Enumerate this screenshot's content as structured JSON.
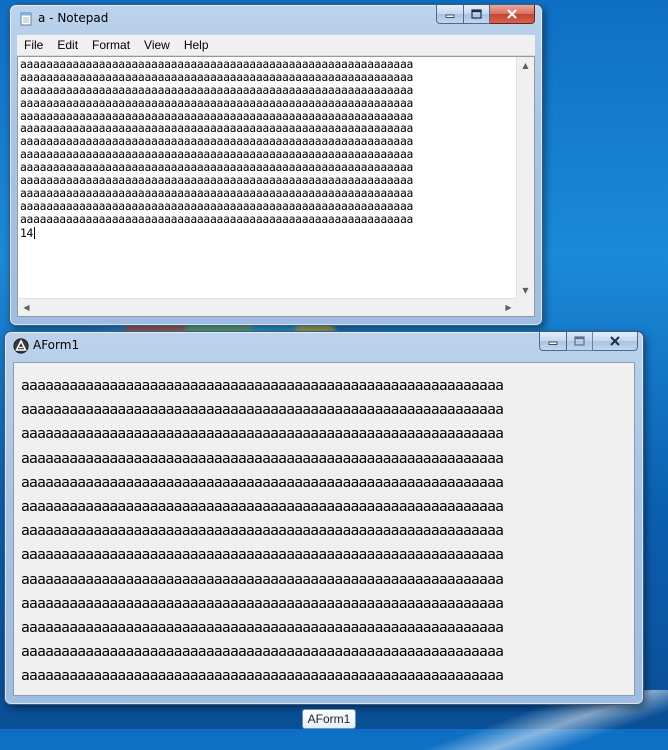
{
  "notepad": {
    "title": "a - Notepad",
    "menu": [
      "File",
      "Edit",
      "Format",
      "View",
      "Help"
    ],
    "lines": [
      "aaaaaaaaaaaaaaaaaaaaaaaaaaaaaaaaaaaaaaaaaaaaaaaaaaaaaaaaaaaa",
      "aaaaaaaaaaaaaaaaaaaaaaaaaaaaaaaaaaaaaaaaaaaaaaaaaaaaaaaaaaaa",
      "aaaaaaaaaaaaaaaaaaaaaaaaaaaaaaaaaaaaaaaaaaaaaaaaaaaaaaaaaaaa",
      "aaaaaaaaaaaaaaaaaaaaaaaaaaaaaaaaaaaaaaaaaaaaaaaaaaaaaaaaaaaa",
      "aaaaaaaaaaaaaaaaaaaaaaaaaaaaaaaaaaaaaaaaaaaaaaaaaaaaaaaaaaaa",
      "aaaaaaaaaaaaaaaaaaaaaaaaaaaaaaaaaaaaaaaaaaaaaaaaaaaaaaaaaaaa",
      "aaaaaaaaaaaaaaaaaaaaaaaaaaaaaaaaaaaaaaaaaaaaaaaaaaaaaaaaaaaa",
      "aaaaaaaaaaaaaaaaaaaaaaaaaaaaaaaaaaaaaaaaaaaaaaaaaaaaaaaaaaaa",
      "aaaaaaaaaaaaaaaaaaaaaaaaaaaaaaaaaaaaaaaaaaaaaaaaaaaaaaaaaaaa",
      "aaaaaaaaaaaaaaaaaaaaaaaaaaaaaaaaaaaaaaaaaaaaaaaaaaaaaaaaaaaa",
      "aaaaaaaaaaaaaaaaaaaaaaaaaaaaaaaaaaaaaaaaaaaaaaaaaaaaaaaaaaaa",
      "aaaaaaaaaaaaaaaaaaaaaaaaaaaaaaaaaaaaaaaaaaaaaaaaaaaaaaaaaaaa",
      "aaaaaaaaaaaaaaaaaaaaaaaaaaaaaaaaaaaaaaaaaaaaaaaaaaaaaaaaaaaa"
    ],
    "last_line": "14",
    "icon": "notepad-icon"
  },
  "aform": {
    "title": "AForm1",
    "lines": [
      "aaaaaaaaaaaaaaaaaaaaaaaaaaaaaaaaaaaaaaaaaaaaaaaaaaaaaaaaaaaa",
      "aaaaaaaaaaaaaaaaaaaaaaaaaaaaaaaaaaaaaaaaaaaaaaaaaaaaaaaaaaaa",
      "aaaaaaaaaaaaaaaaaaaaaaaaaaaaaaaaaaaaaaaaaaaaaaaaaaaaaaaaaaaa",
      "aaaaaaaaaaaaaaaaaaaaaaaaaaaaaaaaaaaaaaaaaaaaaaaaaaaaaaaaaaaa",
      "aaaaaaaaaaaaaaaaaaaaaaaaaaaaaaaaaaaaaaaaaaaaaaaaaaaaaaaaaaaa",
      "aaaaaaaaaaaaaaaaaaaaaaaaaaaaaaaaaaaaaaaaaaaaaaaaaaaaaaaaaaaa",
      "aaaaaaaaaaaaaaaaaaaaaaaaaaaaaaaaaaaaaaaaaaaaaaaaaaaaaaaaaaaa",
      "aaaaaaaaaaaaaaaaaaaaaaaaaaaaaaaaaaaaaaaaaaaaaaaaaaaaaaaaaaaa",
      "aaaaaaaaaaaaaaaaaaaaaaaaaaaaaaaaaaaaaaaaaaaaaaaaaaaaaaaaaaaa",
      "aaaaaaaaaaaaaaaaaaaaaaaaaaaaaaaaaaaaaaaaaaaaaaaaaaaaaaaaaaaa",
      "aaaaaaaaaaaaaaaaaaaaaaaaaaaaaaaaaaaaaaaaaaaaaaaaaaaaaaaaaaaa",
      "aaaaaaaaaaaaaaaaaaaaaaaaaaaaaaaaaaaaaaaaaaaaaaaaaaaaaaaaaaaa",
      "aaaaaaaaaaaaaaaaaaaaaaaaaaaaaaaaaaaaaaaaaaaaaaaaaaaaaaaaaaaa"
    ],
    "icon": "app-logo-icon"
  },
  "taskbar": {
    "label": "AForm1"
  },
  "caption_buttons": {
    "minimize": "minimize-icon",
    "maximize": "maximize-icon",
    "close": "close-icon"
  }
}
